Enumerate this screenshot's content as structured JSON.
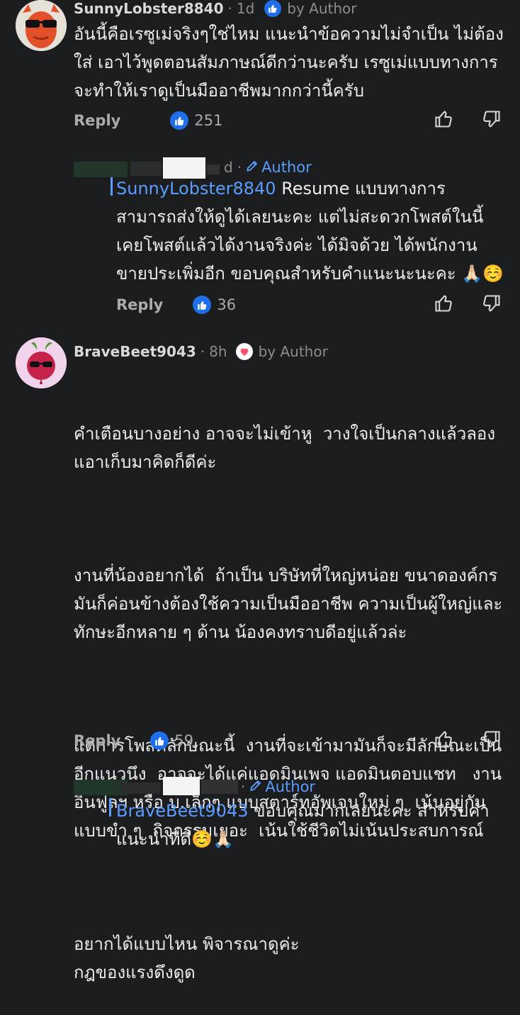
{
  "comments": [
    {
      "username": "SunnyLobster8840",
      "time": "1d",
      "author_label": "by Author",
      "text": "อันนี้คือเรซูเม่จริงๆใช่ไหม แนะนำข้อความไม่จำเป็น ไม่ต้องใส่ เอาไว้พูดตอนสัมภาษณ์ดีกว่านะครับ เรซูเม่แบบทางการจะทำให้เราดูเป็นมืออาชีพมากกว่านี้ครับ",
      "reply_label": "Reply",
      "like_count": "251"
    },
    {
      "username": "BraveBeet9043",
      "time": "8h",
      "author_label": "by Author",
      "text_paragraphs": [
        "คำเตือนบางอย่าง อาจจะไม่เข้าหู  วางใจเป็นกลางแล้วลองแอาเก็บมาคิดก็ดีค่ะ",
        "งานที่น้องอยากได้  ถ้าเป็น บริษัทที่ใหญ่หน่อย ขนาดองค์กรมันก็ค่อนข้างต้องใช้ความเป็นมืออาชีพ ความเป็นผู้ใหญ่และทักษะอีกหลาย ๆ ด้าน น้องคงทราบดีอยู่แล้วล่ะ",
        "แต่การโพสต์ลักษณะนี้  งานที่จะเข้ามามันก็จะมีลักษณะเป็นอีกแนวนึง  อาจจะได้แค่แอดมินเพจ แอดมินตอบแชท   งานอินฟูลฯ หรือ บ.เล็กๆ แบบสตาร์ทอัพเจนใหม่ ๆ  เน้นอยู่กันแบบขำ ๆ  กิจกรรมเยอะ  เน้นใช้ชีวิตไม่เน้นประสบการณ์",
        "อยากได้แบบไหน พิจารณาดูค่ะ\nกฎของแรงดึงดูด"
      ],
      "reply_label": "Reply",
      "like_count": "59"
    }
  ],
  "replies": [
    {
      "time_fragment": "d",
      "author_label": "Author",
      "mention": "SunnyLobster8840",
      "text": " Resume แบบทางการสามารถส่งให้ดูได้เลยนะคะ แต่ไม่สะดวกโพสต์ในนี้ เคยโพสต์แล้วได้งานจริงค่ะ ได้มิจด้วย ได้พนักงานขายประเพิ่มอีก ขอบคุณสำหรับคำแนะนะนะคะ 🙏🏻☺️",
      "reply_label": "Reply",
      "like_count": "36"
    },
    {
      "author_label": "Author",
      "mention": "BraveBeet9043",
      "text": " ขอบคุณมากเลยนะคะ สำหรับคำแนะนำที่ดี☺️🙏🏻"
    }
  ],
  "colors": {
    "background": "#1c1d1f",
    "accent_blue": "#5b9cff",
    "like_blue": "#1f6feb",
    "heart_red": "#ff4f74"
  },
  "icons": [
    "thumbs-up-icon",
    "thumbs-down-icon",
    "pencil-icon",
    "heart-icon",
    "like-icon"
  ]
}
